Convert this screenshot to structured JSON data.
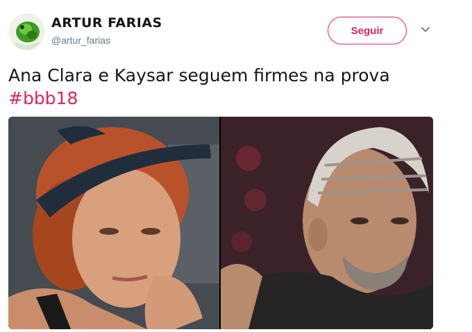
{
  "author": {
    "display_name": "ARTUR FARIAS",
    "handle": "@artur_farias"
  },
  "actions": {
    "follow_label": "Seguir"
  },
  "tweet": {
    "text": "Ana Clara e Kaysar seguem firmes na prova",
    "hashtag": "#bbb18"
  },
  "colors": {
    "accent": "#e0245e",
    "text": "#14171a",
    "secondary": "#657786"
  },
  "icons": {
    "menu": "chevron-down-icon"
  }
}
